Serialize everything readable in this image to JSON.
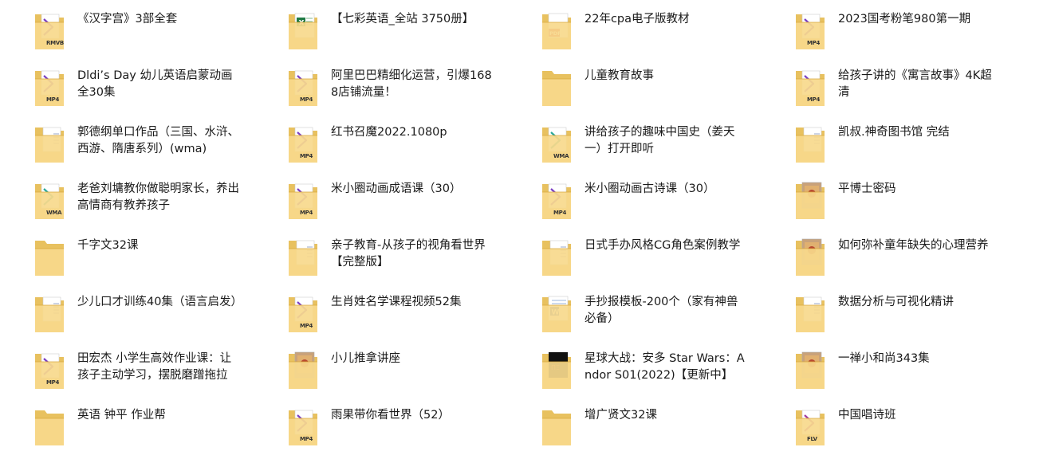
{
  "items": [
    {
      "name": "《汉字宫》3部全套",
      "icon": "folder-rmvb-icon",
      "badge": "RMVB"
    },
    {
      "name": "【七彩英语_全站 3750册】",
      "icon": "folder-excel-icon",
      "badge": ""
    },
    {
      "name": "22年cpa电子版教材",
      "icon": "folder-pdf-icon",
      "badge": ""
    },
    {
      "name": "2023国考粉笔980第一期",
      "icon": "folder-mp4-icon",
      "badge": "MP4"
    },
    {
      "name": "Dldi’s Day 幼儿英语启蒙动画全30集",
      "icon": "folder-mp4-icon",
      "badge": "MP4"
    },
    {
      "name": "阿里巴巴精细化运营，引爆1688店铺流量！",
      "icon": "folder-mp4-icon",
      "badge": "MP4"
    },
    {
      "name": "儿童教育故事",
      "icon": "folder-plain-icon",
      "badge": ""
    },
    {
      "name": "给孩子讲的《寓言故事》4K超清",
      "icon": "folder-mp4-icon",
      "badge": "MP4"
    },
    {
      "name": "郭德纲单口作品（三国、水浒、西游、隋唐系列）(wma)",
      "icon": "folder-doc-icon",
      "badge": ""
    },
    {
      "name": "红书召魔2022.1080p",
      "icon": "folder-mp4-icon",
      "badge": "MP4"
    },
    {
      "name": "讲给孩子的趣味中国史（姜天一）打开即听",
      "icon": "folder-wma-icon",
      "badge": "WMA"
    },
    {
      "name": "凯叔.神奇图书馆 完结",
      "icon": "folder-doc-icon",
      "badge": ""
    },
    {
      "name": "老爸刘墉教你做聪明家长，养出高情商有教养孩子",
      "icon": "folder-wma-icon",
      "badge": "WMA"
    },
    {
      "name": "米小圈动画成语课（30）",
      "icon": "folder-mp4-icon",
      "badge": "MP4"
    },
    {
      "name": "米小圈动画古诗课（30）",
      "icon": "folder-mp4-icon",
      "badge": "MP4"
    },
    {
      "name": "平博士密码",
      "icon": "folder-image-icon",
      "badge": ""
    },
    {
      "name": "千字文32课",
      "icon": "folder-plain-icon",
      "badge": ""
    },
    {
      "name": "亲子教育-从孩子的视角看世界【完整版】",
      "icon": "folder-doc-icon",
      "badge": ""
    },
    {
      "name": "日式手办风格CG角色案例教学",
      "icon": "folder-doc-icon",
      "badge": ""
    },
    {
      "name": "如何弥补童年缺失的心理营养",
      "icon": "folder-image-icon",
      "badge": ""
    },
    {
      "name": "少儿口才训练40集（语言启发）",
      "icon": "folder-doc-icon",
      "badge": ""
    },
    {
      "name": "生肖姓名学课程视频52集",
      "icon": "folder-mp4-icon",
      "badge": "MP4"
    },
    {
      "name": "手抄报模板-200个（家有神兽必备）",
      "icon": "folder-word-icon",
      "badge": ""
    },
    {
      "name": "数据分析与可视化精讲",
      "icon": "folder-doc-icon",
      "badge": ""
    },
    {
      "name": "田宏杰 小学生高效作业课：让孩子主动学习，摆脱磨蹭拖拉",
      "icon": "folder-mp4-icon",
      "badge": "MP4"
    },
    {
      "name": "小儿推拿讲座",
      "icon": "folder-image-icon",
      "badge": ""
    },
    {
      "name": "星球大战：安多 Star Wars：Andor S01(2022)【更新中】",
      "icon": "folder-dark-icon",
      "badge": ""
    },
    {
      "name": "一禅小和尚343集",
      "icon": "folder-image-icon",
      "badge": ""
    },
    {
      "name": "英语 钟平 作业帮",
      "icon": "folder-plain-icon",
      "badge": ""
    },
    {
      "name": "雨果带你看世界（52）",
      "icon": "folder-mp4-icon",
      "badge": "MP4"
    },
    {
      "name": "增广贤文32课",
      "icon": "folder-plain-icon",
      "badge": ""
    },
    {
      "name": "中国唱诗班",
      "icon": "folder-flv-icon",
      "badge": "FLV"
    }
  ],
  "colors": {
    "folder_back": "#e8c15f",
    "folder_front": "#f7d98c",
    "mp4": "#7a3fc4",
    "wma": "#2ba89a",
    "excel": "#1f7a44",
    "word": "#2b5cb8",
    "pdf": "#d9362a"
  }
}
